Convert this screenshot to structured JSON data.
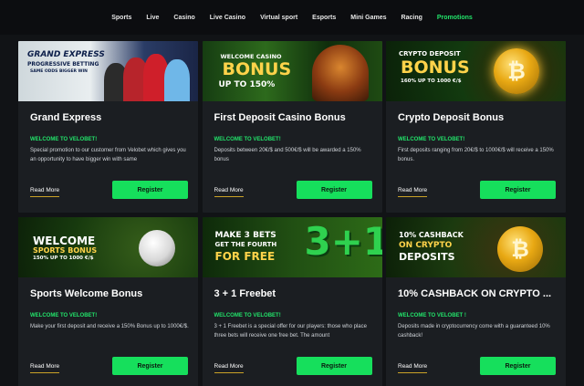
{
  "nav": {
    "items": [
      {
        "label": "Sports",
        "active": false
      },
      {
        "label": "Live",
        "active": false
      },
      {
        "label": "Casino",
        "active": false
      },
      {
        "label": "Live Casino",
        "active": false
      },
      {
        "label": "Virtual sport",
        "active": false
      },
      {
        "label": "Esports",
        "active": false
      },
      {
        "label": "Mini Games",
        "active": false
      },
      {
        "label": "Racing",
        "active": false
      },
      {
        "label": "Promotions",
        "active": true
      }
    ],
    "active_color": "#22e36a"
  },
  "promotions": [
    {
      "title": "Grand Express",
      "welcome": "WELCOME TO VELOBET!",
      "description": "Special promotion to our customer from Velobet which gives you an opportunity to  have bigger win with same",
      "read_more": "Read More",
      "register": "Register",
      "banner": {
        "line1": "GRAND EXPRESS",
        "line2": "PROGRESSIVE BETTING",
        "line3": "SAME ODDS BIGGER WIN"
      }
    },
    {
      "title": "First Deposit Casino Bonus",
      "welcome": "WELCOME TO VELOBET!",
      "description": "Deposits between 20€/$ and 500€/$ will be awarded a 150% bonus",
      "read_more": "Read More",
      "register": "Register",
      "banner": {
        "line1": "WELCOME CASINO",
        "line2": "BONUS",
        "line3": "UP TO 150%"
      }
    },
    {
      "title": "Crypto Deposit Bonus",
      "welcome": "WELCOME TO VELOBET!",
      "description": "First deposits ranging from 20€/$ to 1000€/$ will receive a 150% bonus.",
      "read_more": "Read More",
      "register": "Register",
      "banner": {
        "line1": "CRYPTO DEPOSIT",
        "line2": "BONUS",
        "line3": "160% UP TO 1000 €/$"
      }
    },
    {
      "title": "Sports Welcome Bonus",
      "welcome": "WELCOME TO VELOBET!",
      "description": "Make your first deposit and receive a 150% Bonus up to 1000€/$.",
      "read_more": "Read More",
      "register": "Register",
      "banner": {
        "line1": "WELCOME",
        "line2": "SPORTS BONUS",
        "line3": "150% UP TO 1000 €/$"
      }
    },
    {
      "title": "3 + 1 Freebet",
      "welcome": "WELCOME TO VELOBET!",
      "description": "3 + 1 Freebet is a special offer for our players: those who place three bets will receive one free bet. The amount",
      "read_more": "Read More",
      "register": "Register",
      "banner": {
        "line1": "MAKE 3 BETS",
        "line2": "GET THE FOURTH",
        "line3": "FOR FREE",
        "big": "3+1"
      }
    },
    {
      "title": "10% CASHBACK ON CRYPTO ...",
      "welcome": "WELCOME TO VELOBET !",
      "description": "Deposits made in cryptocurrency come with a guaranteed 10% cashback!",
      "read_more": "Read More",
      "register": "Register",
      "banner": {
        "line1": "10% CASHBACK",
        "line2": "ON CRYPTO",
        "line3": "DEPOSITS"
      }
    }
  ],
  "colors": {
    "accent_green": "#16df5c",
    "read_more_underline": "#c9a227",
    "card_bg": "#1b1e22",
    "page_bg": "#111316"
  }
}
